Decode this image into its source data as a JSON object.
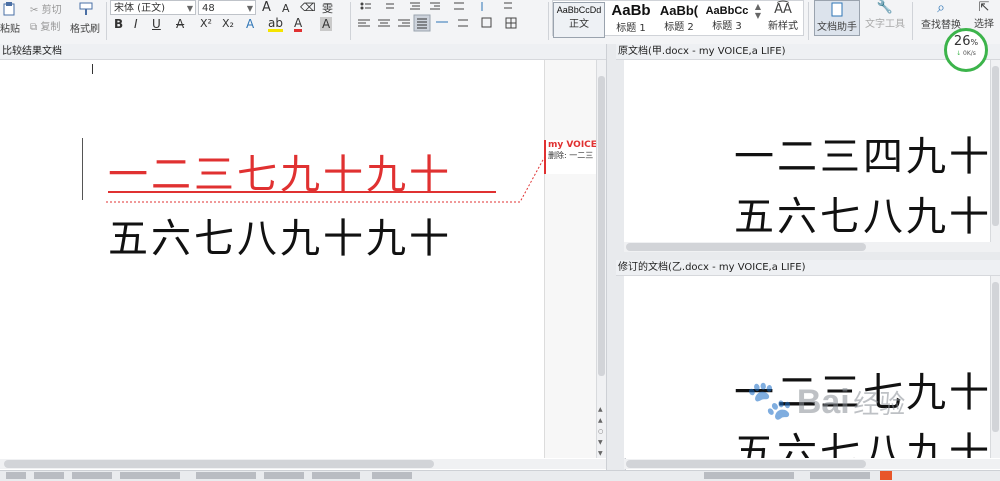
{
  "ribbon": {
    "paste_label": "粘贴",
    "cut_label": "剪切",
    "copy_label": "复制",
    "format_painter_label": "格式刷",
    "font_name": "宋体 (正文)",
    "font_size": "48",
    "grow_label": "A",
    "shrink_label": "A",
    "clear_label": "⌫",
    "phonetic_label": "雯",
    "bold_label": "B",
    "italic_label": "I",
    "underline_label": "U",
    "strike_label": "A",
    "super_label": "X²",
    "sub_label": "X₂",
    "effect_label": "A",
    "highlight_label": "ab",
    "fontcolor_label": "A",
    "charshade_label": "A",
    "styles": [
      {
        "sample": "AaBbCcDd",
        "name": "正文"
      },
      {
        "sample": "AaBb",
        "name": "标题 1"
      },
      {
        "sample": "AaBb(",
        "name": "标题 2"
      },
      {
        "sample": "AaBbCc",
        "name": "标题 3"
      }
    ],
    "new_style_label": "新样式",
    "doc_assistant_label": "文档助手",
    "text_tools_label": "文字工具",
    "find_replace_label": "查找替换",
    "select_label": "选择",
    "accent_color": "#2e75b6"
  },
  "left_pane": {
    "title": "比较结果文档",
    "line1": "一二三七九十九十",
    "line2": "五六七八九十九十",
    "revision_color": "#e03131",
    "comment_author": "my VOICE,",
    "comment_text": "删除: 一二三"
  },
  "top_right_pane": {
    "title": "原文档(甲.docx - my VOICE,a LIFE)",
    "line1": "一二三四九十",
    "line2": "五六七八九十"
  },
  "bottom_right_pane": {
    "title": "修订的文档(乙.docx - my VOICE,a LIFE)",
    "line1": "一二三七九十",
    "line2": "五六七八九十"
  },
  "speed_widget": {
    "percent": "26",
    "percent_unit": "%",
    "rate": "0K/s",
    "color": "#3cb44b"
  },
  "watermark": {
    "text": "Bai",
    "sub": "经验"
  }
}
